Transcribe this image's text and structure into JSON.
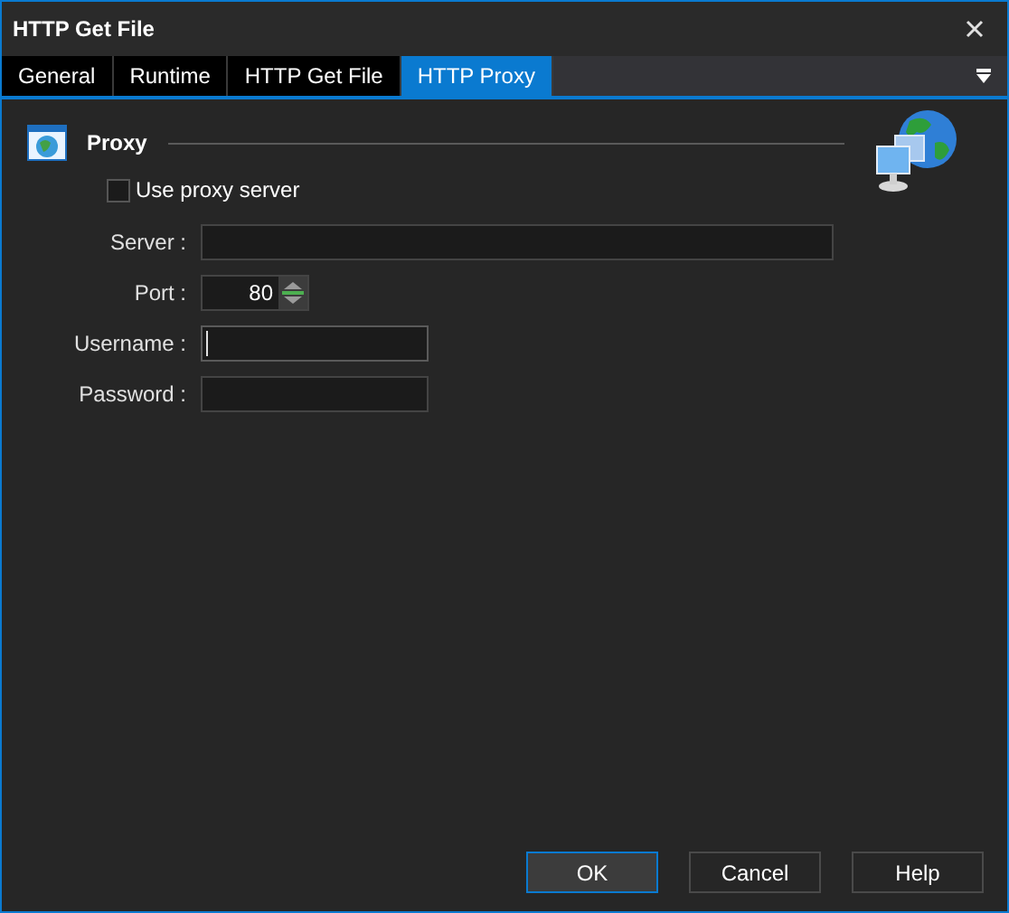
{
  "window": {
    "title": "HTTP Get File"
  },
  "tabs": [
    {
      "label": "General",
      "selected": false
    },
    {
      "label": "Runtime",
      "selected": false
    },
    {
      "label": "HTTP Get File",
      "selected": false
    },
    {
      "label": "HTTP Proxy",
      "selected": true
    }
  ],
  "section": {
    "title": "Proxy"
  },
  "use_proxy": {
    "label": "Use proxy server",
    "checked": false
  },
  "fields": [
    {
      "kind": "wide",
      "label": "Server :",
      "focused": false
    },
    {
      "kind": "spin",
      "label": "Port :",
      "value": "80",
      "focused": false
    },
    {
      "kind": "text",
      "label": "Username :",
      "focused": true
    },
    {
      "kind": "text",
      "label": "Password :",
      "focused": false
    }
  ],
  "buttons": [
    {
      "label": "OK",
      "default": true
    },
    {
      "label": "Cancel",
      "default": false
    },
    {
      "label": "Help",
      "default": false
    }
  ]
}
